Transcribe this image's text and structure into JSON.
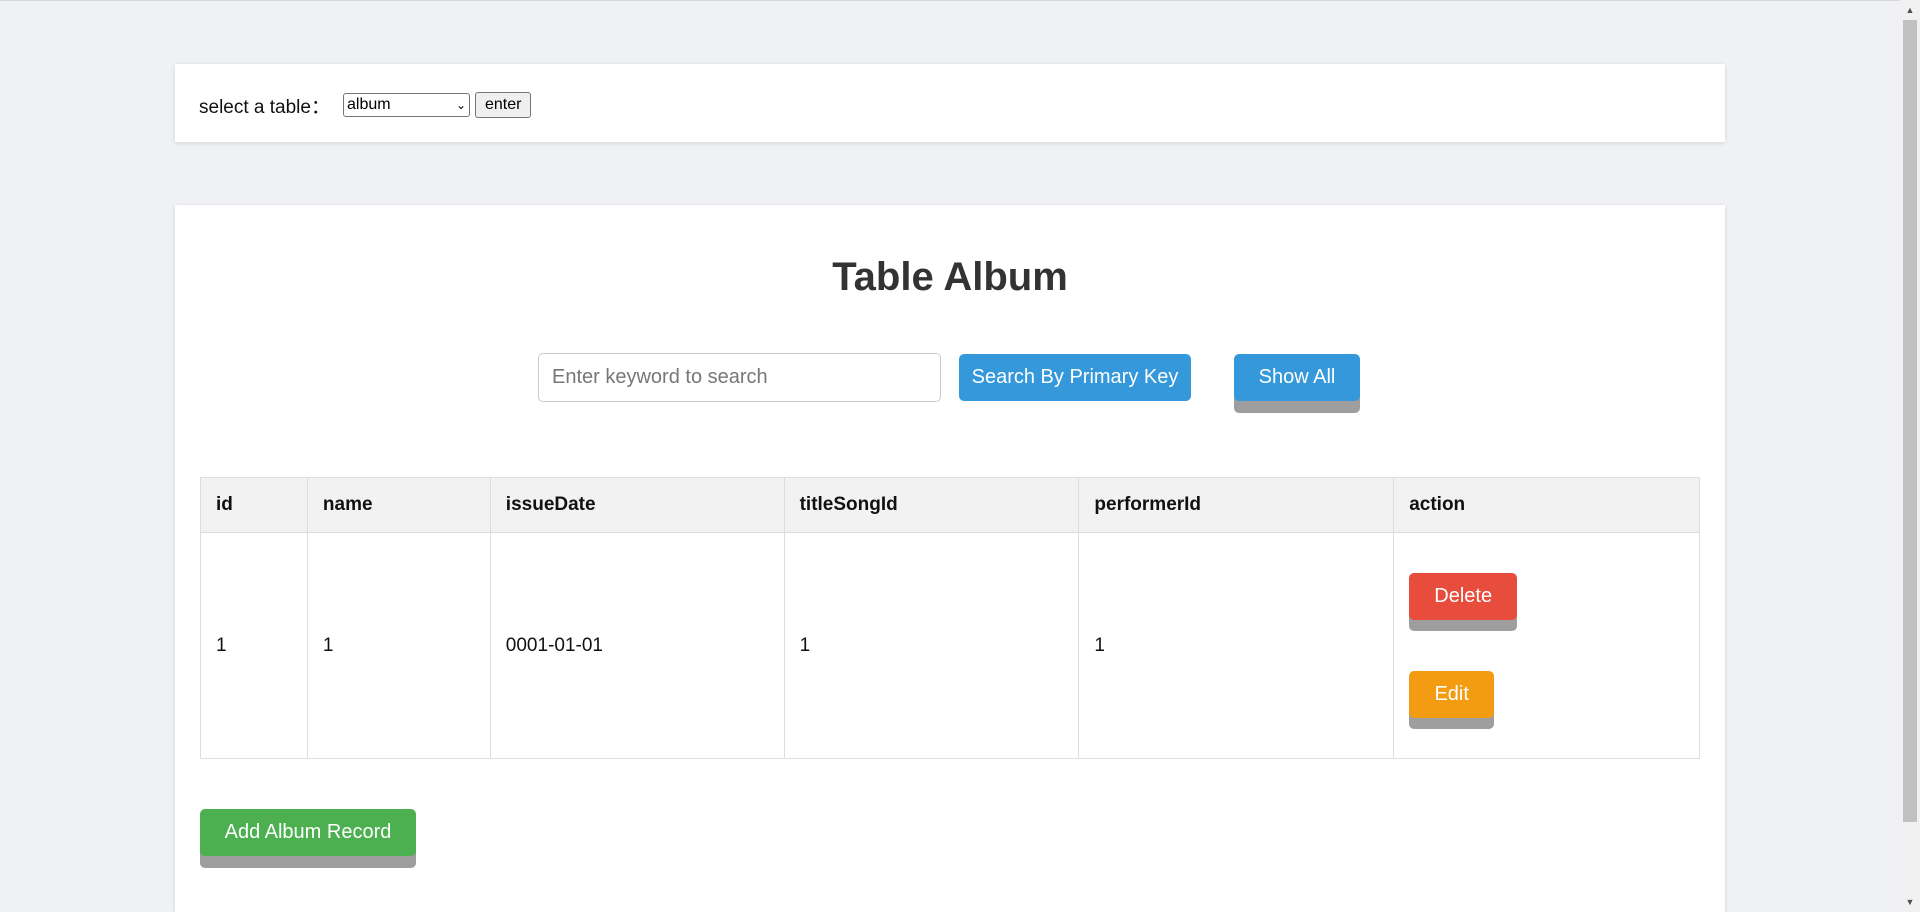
{
  "selector": {
    "label": "select a table：",
    "selected_value": "album",
    "enter_label": "enter"
  },
  "main": {
    "title": "Table Album",
    "search": {
      "placeholder": "Enter keyword to search",
      "search_button": "Search By Primary Key",
      "show_all_button": "Show All"
    },
    "table": {
      "headers": [
        "id",
        "name",
        "issueDate",
        "titleSongId",
        "performerId",
        "action"
      ],
      "rows": [
        {
          "id": "1",
          "name": "1",
          "issueDate": "0001-01-01",
          "titleSongId": "1",
          "performerId": "1",
          "delete_label": "Delete",
          "edit_label": "Edit"
        }
      ]
    },
    "add_button": "Add Album Record"
  },
  "colors": {
    "primary": "#3498db",
    "danger": "#e74c3c",
    "warning": "#f39c12",
    "success": "#4caf50",
    "page_background": "#f0f1f4"
  },
  "icons": {
    "select_chevron": "chevron-down-icon",
    "scroll_up": "scroll-up-arrow-icon",
    "scroll_down": "scroll-down-arrow-icon"
  }
}
